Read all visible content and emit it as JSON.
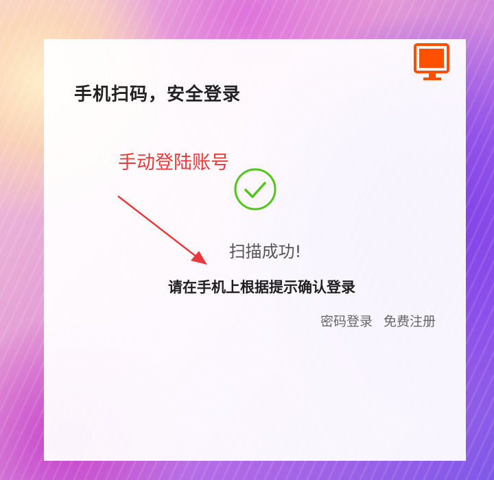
{
  "login": {
    "title": "手机扫码，安全登录",
    "annotation": "手动登陆账号",
    "scan_status": "扫描成功!",
    "instruction": "请在手机上根据提示确认登录",
    "links": {
      "password_login": "密码登录",
      "register": "免费注册"
    }
  },
  "icons": {
    "corner": "computer-monitor-icon",
    "status": "check-circle-icon"
  },
  "colors": {
    "accent_orange": "#ff4f00",
    "success_green": "#52c41a",
    "annotation_red": "#e8393d",
    "card_bg": "#ffffff"
  }
}
